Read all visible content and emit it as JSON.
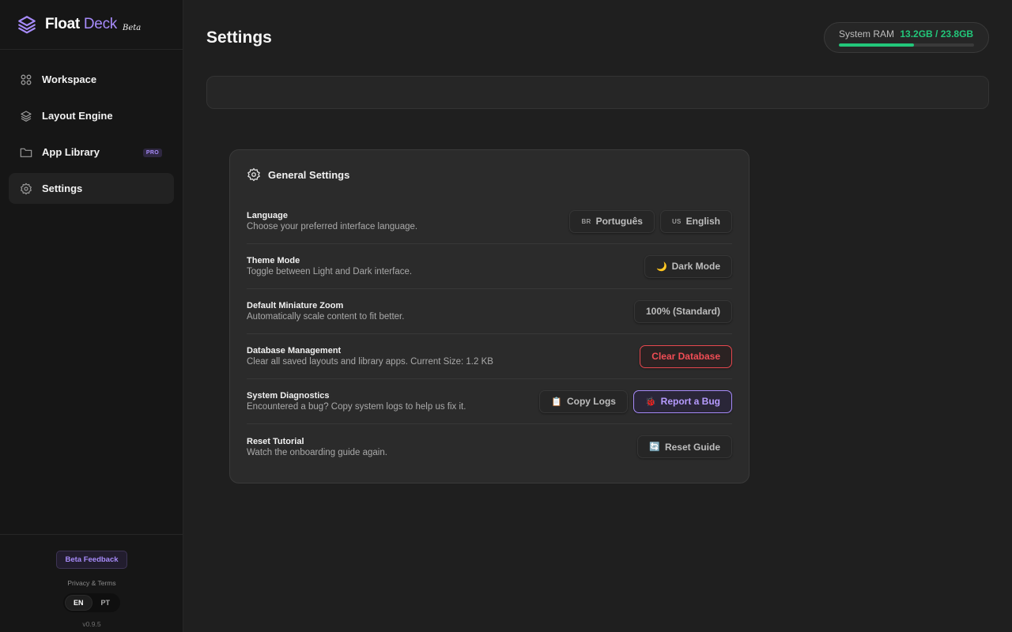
{
  "brand": {
    "name_bold": "Float",
    "name_light": "Deck",
    "tag": "Beta"
  },
  "nav": {
    "items": [
      {
        "label": "Workspace",
        "icon": "grid-icon"
      },
      {
        "label": "Layout Engine",
        "icon": "layers-icon"
      },
      {
        "label": "App Library",
        "icon": "folder-icon",
        "badge": "PRO"
      },
      {
        "label": "Settings",
        "icon": "gear-icon",
        "active": true
      }
    ]
  },
  "footer": {
    "feedback_label": "Beta Feedback",
    "privacy_label": "Privacy & Terms",
    "lang_en": "EN",
    "lang_pt": "PT",
    "version": "v0.9.5"
  },
  "header": {
    "title": "Settings",
    "ram_label": "System RAM",
    "ram_value": "13.2GB / 23.8GB",
    "ram_fraction": 0.555
  },
  "settings": {
    "title": "General Settings",
    "language": {
      "title": "Language",
      "desc": "Choose your preferred interface language.",
      "opt1_flag": "BR",
      "opt1": "Português",
      "opt2_flag": "US",
      "opt2": "English"
    },
    "theme": {
      "title": "Theme Mode",
      "desc": "Toggle between Light and Dark interface.",
      "emoji": "🌙",
      "button": "Dark Mode"
    },
    "zoom": {
      "title": "Default Miniature Zoom",
      "desc": "Automatically scale content to fit better.",
      "button": "100% (Standard)"
    },
    "database": {
      "title": "Database Management",
      "desc": "Clear all saved layouts and library apps. Current Size: 1.2 KB",
      "button": "Clear Database"
    },
    "diagnostics": {
      "title": "System Diagnostics",
      "desc": "Encountered a bug? Copy system logs to help us fix it.",
      "copy_emoji": "📋",
      "copy_button": "Copy Logs",
      "bug_emoji": "🐞",
      "bug_button": "Report a Bug"
    },
    "tutorial": {
      "title": "Reset Tutorial",
      "desc": "Watch the onboarding guide again.",
      "emoji": "🔄",
      "button": "Reset Guide"
    }
  },
  "colors": {
    "accent": "#a78bfa",
    "ram_green": "#22c77a",
    "danger": "#f04d55"
  }
}
